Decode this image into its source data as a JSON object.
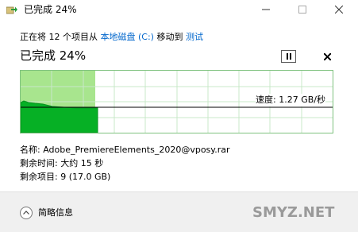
{
  "window": {
    "title": "已完成 24%",
    "icon": "copy-arrow-icon",
    "controls": [
      "minimize-icon",
      "maximize-icon",
      "close-icon"
    ]
  },
  "copy_line": {
    "prefix": "正在将 12 个项目从 ",
    "source": "本地磁盘 (C:)",
    "middle": " 移动到 ",
    "destination": "测试"
  },
  "progress_title": "已完成 24%",
  "progress": 0.24,
  "speed_label": "速度: 1.27 GB/秒",
  "details": {
    "name": "名称: Adobe_PremiereElements_2020@vposy.rar",
    "time_remaining": "剩余时间: 大约 15 秒",
    "items_remaining": "剩余项目: 9 (17.0 GB)"
  },
  "footer": {
    "less_details": "简略信息"
  },
  "watermark": "SMYZ.NET",
  "colors": {
    "graph_fill_light": "#a8e58e",
    "graph_fill_dark": "#06b025",
    "graph_border": "#7fc27f",
    "link": "#0066cc"
  }
}
